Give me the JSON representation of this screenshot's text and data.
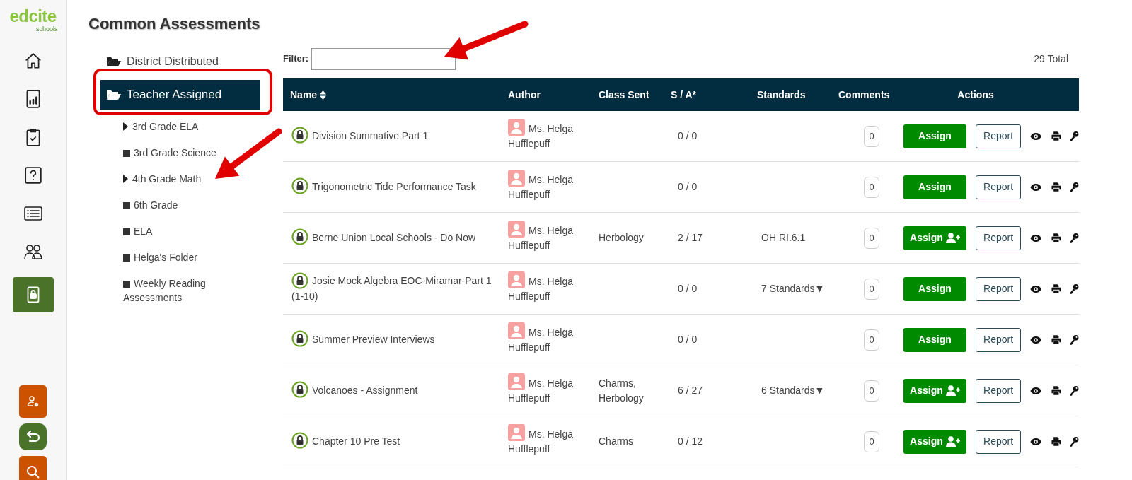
{
  "logo": {
    "wordmark": "edcite",
    "tagline": "schools"
  },
  "nav": [
    {
      "kind": "home",
      "selected": false
    },
    {
      "kind": "chart",
      "selected": false
    },
    {
      "kind": "clipboard",
      "selected": false
    },
    {
      "kind": "question",
      "selected": false
    },
    {
      "kind": "list",
      "selected": false
    },
    {
      "kind": "users",
      "selected": false
    },
    {
      "kind": "lock",
      "selected": true
    }
  ],
  "bottom_buttons": [
    {
      "kind": "user-settings",
      "color": "#cc5200"
    },
    {
      "kind": "undo",
      "color": "#4a7229"
    },
    {
      "kind": "search",
      "color": "#cc5200"
    }
  ],
  "page_title": "Common Assessments",
  "folders": [
    {
      "label": "District Distributed",
      "selected": false
    },
    {
      "label": "Teacher Assigned",
      "selected": true,
      "children": [
        {
          "label": "3rd Grade ELA",
          "kind": "expandable"
        },
        {
          "label": "3rd Grade Science",
          "kind": "leaf"
        },
        {
          "label": "4th Grade Math",
          "kind": "expandable"
        },
        {
          "label": "6th Grade",
          "kind": "leaf"
        },
        {
          "label": "ELA",
          "kind": "leaf"
        },
        {
          "label": "Helga's Folder",
          "kind": "leaf"
        },
        {
          "label": "Weekly Reading Assessments",
          "kind": "leaf"
        }
      ]
    }
  ],
  "filter": {
    "label": "Filter:"
  },
  "total": "29 Total",
  "table": {
    "columns": [
      {
        "label": "Name",
        "sortable": true
      },
      {
        "label": "Author",
        "sortable": false
      },
      {
        "label": "Class Sent",
        "sortable": false
      },
      {
        "label": "S / A*",
        "sortable": false
      },
      {
        "label": "Standards",
        "sortable": false
      },
      {
        "label": "Comments",
        "sortable": false
      },
      {
        "label": "Actions",
        "sortable": false
      }
    ],
    "rows": [
      {
        "name": "Division Summative Part 1",
        "author": "Ms. Helga Hufflepuff",
        "class_sent": "",
        "s_a": "0 / 0",
        "standards": "",
        "comments": "0",
        "assign": "Assign",
        "assign_icon": false,
        "report": "Report"
      },
      {
        "name": "Trigonometric Tide Performance Task",
        "author": "Ms. Helga Hufflepuff",
        "class_sent": "",
        "s_a": "0 / 0",
        "standards": "",
        "comments": "0",
        "assign": "Assign",
        "assign_icon": false,
        "report": "Report"
      },
      {
        "name": "Berne Union Local Schools - Do Now",
        "author": "Ms. Helga Hufflepuff",
        "class_sent": "Herbology",
        "s_a": "2 / 17",
        "standards": "OH RI.6.1",
        "comments": "0",
        "assign": "Assign",
        "assign_icon": true,
        "report": "Report"
      },
      {
        "name": "Josie Mock Algebra EOC-Miramar-Part 1 (1-10)",
        "author": "Ms. Helga Hufflepuff",
        "class_sent": "",
        "s_a": "0 / 0",
        "standards": "7 Standards▼",
        "comments": "0",
        "assign": "Assign",
        "assign_icon": false,
        "report": "Report"
      },
      {
        "name": "Summer Preview Interviews",
        "author": "Ms. Helga Hufflepuff",
        "class_sent": "",
        "s_a": "0 / 0",
        "standards": "",
        "comments": "0",
        "assign": "Assign",
        "assign_icon": false,
        "report": "Report"
      },
      {
        "name": "Volcanoes - Assignment",
        "author": "Ms. Helga Hufflepuff",
        "class_sent": "Charms, Herbology",
        "s_a": "6 / 27",
        "standards": "6 Standards▼",
        "comments": "0",
        "assign": "Assign",
        "assign_icon": true,
        "report": "Report"
      },
      {
        "name": "Chapter 10 Pre Test",
        "author": "Ms. Helga Hufflepuff",
        "class_sent": "Charms",
        "s_a": "0 / 12",
        "standards": "",
        "comments": "0",
        "assign": "Assign",
        "assign_icon": true,
        "report": "Report"
      }
    ]
  },
  "annotations": [
    {
      "kind": "highlight-box"
    },
    {
      "kind": "arrow"
    },
    {
      "kind": "arrow"
    }
  ]
}
